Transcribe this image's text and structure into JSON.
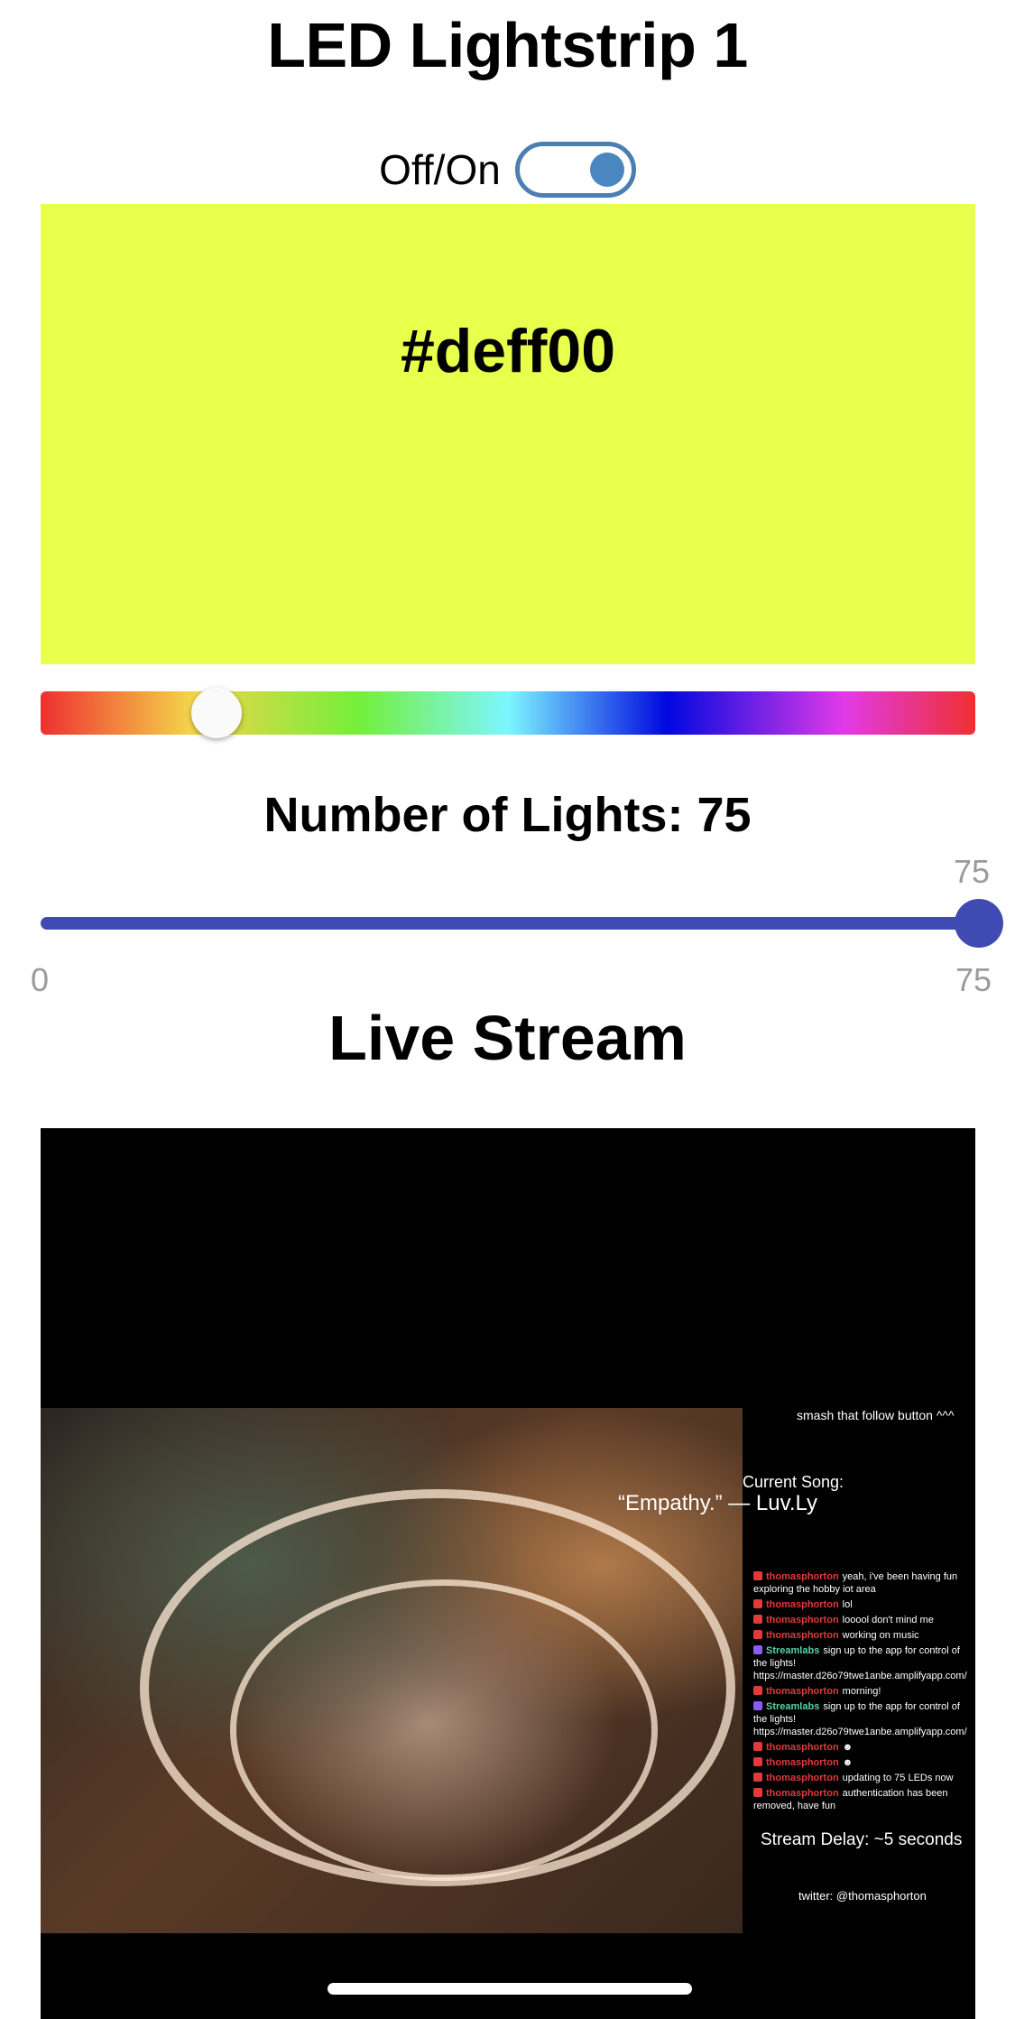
{
  "header": {
    "title": "LED Lightstrip 1"
  },
  "power": {
    "label": "Off/On",
    "on": true
  },
  "color": {
    "hex": "#deff00",
    "display": "#deff00",
    "hue_position_fraction": 0.188
  },
  "lights": {
    "title": "Number of Lights: 75",
    "value": "75",
    "value_fraction": 1.0,
    "min": "0",
    "max": "75"
  },
  "stream": {
    "title": "Live Stream",
    "follow_text": "smash that follow button ^^^",
    "song_label": "Current Song:",
    "song_name": "“Empathy.” — Luv.Ly",
    "chat": [
      {
        "kind": "r",
        "user": "thomasphorton",
        "user_color": "r",
        "text": "yeah, i've been having fun exploring the hobby iot area"
      },
      {
        "kind": "r",
        "user": "thomasphorton",
        "user_color": "r",
        "text": "lol"
      },
      {
        "kind": "r",
        "user": "thomasphorton",
        "user_color": "r",
        "text": "looool don't mind me"
      },
      {
        "kind": "r",
        "user": "thomasphorton",
        "user_color": "r",
        "text": "working on music"
      },
      {
        "kind": "p",
        "user": "Streamlabs",
        "user_color": "g",
        "text": "sign up to the app for control of the lights! https://master.d26o79twe1anbe.amplifyapp.com/"
      },
      {
        "kind": "r",
        "user": "thomasphorton",
        "user_color": "r",
        "text": "morning!"
      },
      {
        "kind": "p",
        "user": "Streamlabs",
        "user_color": "g",
        "text": "sign up to the app for control of the lights! https://master.d26o79twe1anbe.amplifyapp.com/"
      },
      {
        "kind": "r",
        "user": "thomasphorton",
        "user_color": "r",
        "text": "☻"
      },
      {
        "kind": "r",
        "user": "thomasphorton",
        "user_color": "r",
        "text": "☻"
      },
      {
        "kind": "r",
        "user": "thomasphorton",
        "user_color": "r",
        "text": "updating to 75 LEDs now"
      },
      {
        "kind": "r",
        "user": "thomasphorton",
        "user_color": "r",
        "text": "authentication has been removed, have fun"
      }
    ],
    "delay": "Stream Delay: ~5 seconds",
    "twitter": "twitter: @thomasphorton"
  },
  "colors": {
    "accent_toggle": "#4a7fb0",
    "slider": "#3f4bb3",
    "muted_text": "#9b9b9b"
  },
  "icons": {
    "chat_badge_red": "video-icon",
    "chat_badge_purple": "streamlabs-icon"
  }
}
